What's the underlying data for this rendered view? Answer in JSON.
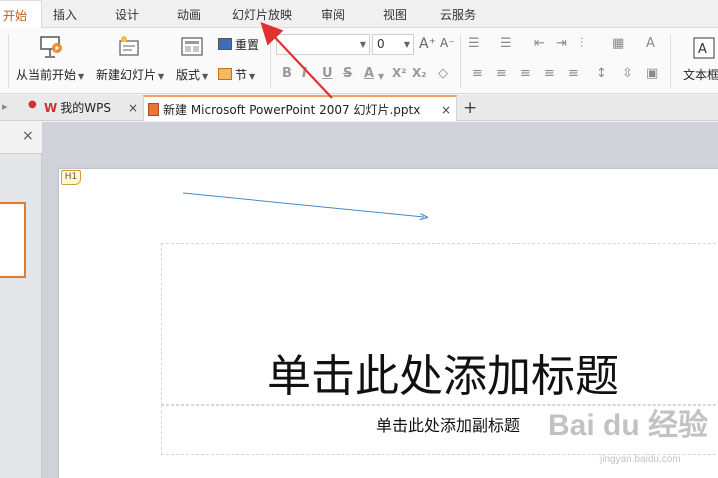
{
  "menu": {
    "tabs": [
      {
        "label": "开始",
        "active": true
      },
      {
        "label": "插入"
      },
      {
        "label": "设计"
      },
      {
        "label": "动画"
      },
      {
        "label": "幻灯片放映"
      },
      {
        "label": "审阅"
      },
      {
        "label": "视图"
      },
      {
        "label": "云服务"
      }
    ]
  },
  "ribbon": {
    "from_current": "从当前开始",
    "new_slide": "新建幻灯片",
    "layout": "版式",
    "reset": "重置",
    "section": "节",
    "font_name": "",
    "font_size": "0",
    "grow_font": "A⁺",
    "shrink_font": "A⁻",
    "bold": "B",
    "italic": "I",
    "underline": "U",
    "strike": "S",
    "shadow": "S",
    "font_color": "A",
    "superscript": "X²",
    "subscript": "X₂",
    "textbox": "文本框"
  },
  "doc_tabs": {
    "wps_home": "我的WPS",
    "file": "新建 Microsoft PowerPoint 2007 幻灯片.pptx",
    "close_glyph": "×",
    "add_glyph": "+"
  },
  "panel": {
    "close_glyph": "×"
  },
  "slide": {
    "anchor": "H1",
    "title": "单击此处添加标题",
    "subtitle": "单击此处添加副标题"
  },
  "watermark": {
    "brand": "Bai du 经验",
    "url": "jingyan.baidu.com"
  },
  "colors": {
    "accent": "#c45a18",
    "annotation_arrow": "#e03030",
    "slide_arrow": "#4a86c8"
  }
}
